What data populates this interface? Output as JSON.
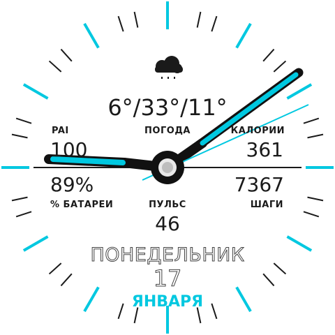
{
  "colors": {
    "accent": "#00c8e0",
    "tick": "#1a1a1a",
    "text": "#1a1a1a",
    "background": "#ffffff"
  },
  "weather": {
    "icon": "rain-cloud-icon",
    "temps": "6°/33°/11°",
    "label": "ПОГОДА"
  },
  "pai": {
    "label": "PAI",
    "value": "100"
  },
  "battery": {
    "value": "89%",
    "label": "% БАТАРЕИ"
  },
  "calories": {
    "label": "КАЛОРИИ",
    "value": "361"
  },
  "steps": {
    "value": "7367",
    "label": "ШАГИ"
  },
  "pulse": {
    "label": "ПУЛЬС",
    "value": "46"
  },
  "date": {
    "weekday": "ПОНЕДЕЛЬНИК",
    "day": "17",
    "month": "ЯНВАРЯ"
  }
}
